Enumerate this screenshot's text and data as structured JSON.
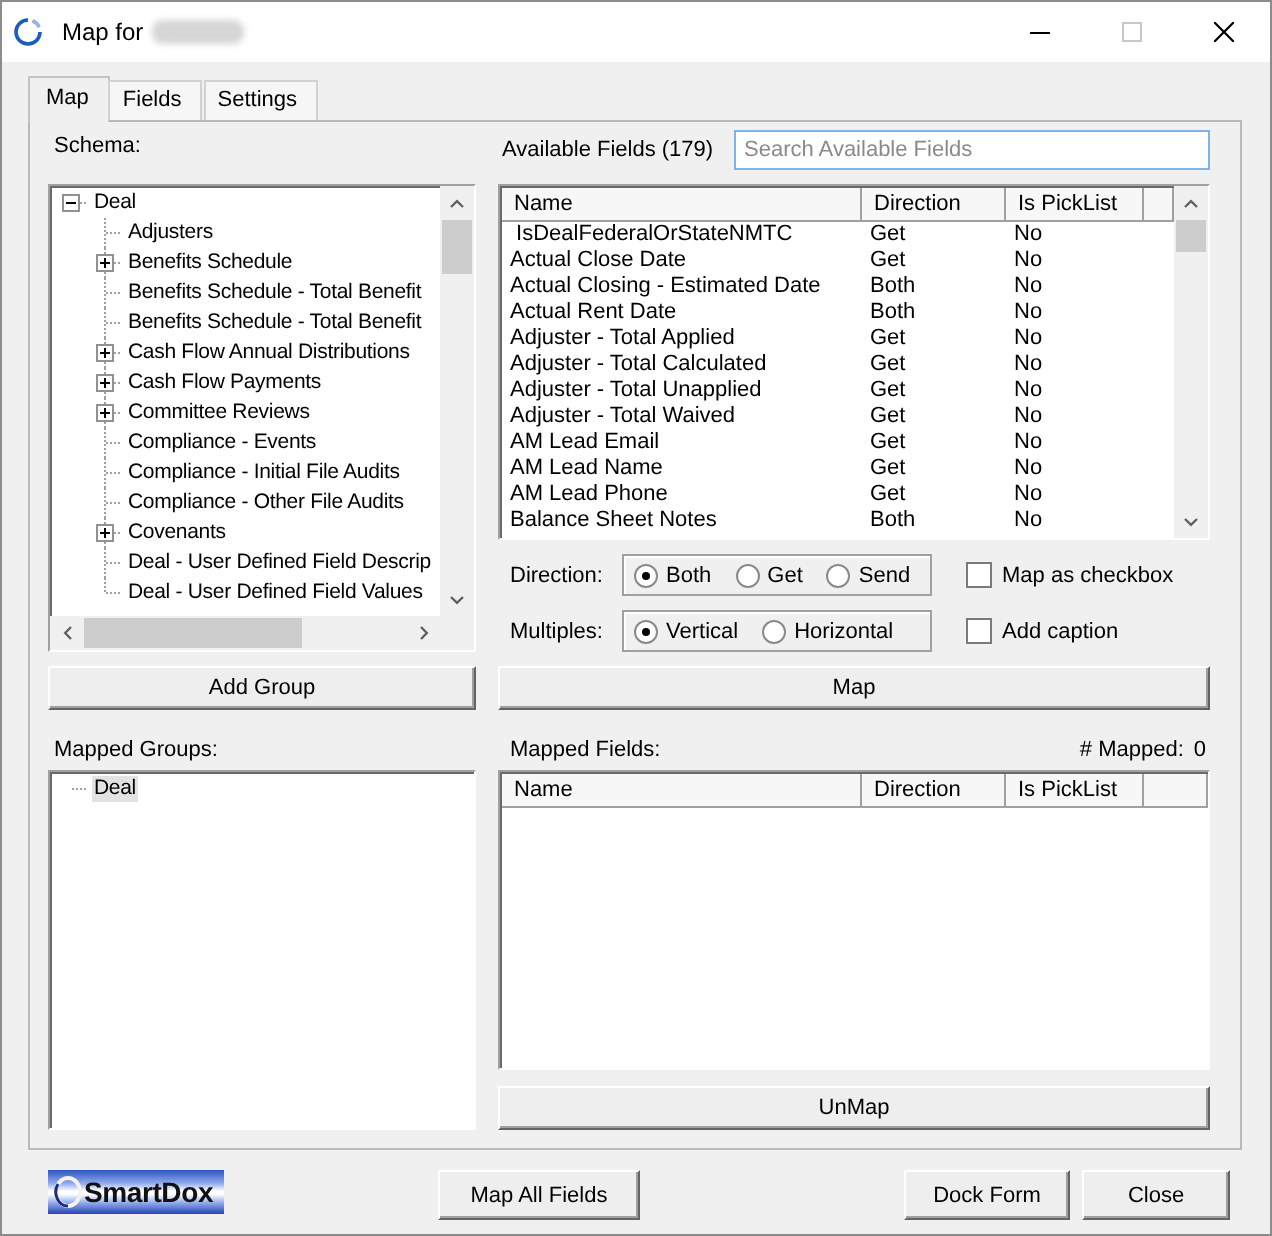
{
  "window": {
    "title": "Map for",
    "controls": [
      {
        "kind": "minimize",
        "disabled": false
      },
      {
        "kind": "maximize",
        "disabled": true
      },
      {
        "kind": "close",
        "disabled": false
      }
    ]
  },
  "tabs": [
    {
      "label": "Map",
      "selected": true
    },
    {
      "label": "Fields",
      "selected": false
    },
    {
      "label": "Settings",
      "selected": false
    }
  ],
  "schema": {
    "label": "Schema:",
    "tree": [
      {
        "label": "Deal",
        "expanded": true,
        "selected": false,
        "children": [
          {
            "label": "Adjusters",
            "selected": false
          },
          {
            "label": "Benefits Schedule",
            "expanded": false,
            "selected": false
          },
          {
            "label": "Benefits Schedule - Total Benefit",
            "selected": false
          },
          {
            "label": "Benefits Schedule - Total Benefit",
            "selected": false
          },
          {
            "label": "Cash Flow Annual Distributions",
            "expanded": false,
            "selected": false
          },
          {
            "label": "Cash Flow Payments",
            "expanded": false,
            "selected": false
          },
          {
            "label": "Committee Reviews",
            "expanded": false,
            "selected": false
          },
          {
            "label": "Compliance - Events",
            "selected": false
          },
          {
            "label": "Compliance - Initial File Audits",
            "selected": false
          },
          {
            "label": "Compliance - Other File Audits",
            "selected": false
          },
          {
            "label": "Covenants",
            "expanded": false,
            "selected": false
          },
          {
            "label": "Deal - User Defined Field Descrip",
            "selected": false
          },
          {
            "label": "Deal - User Defined Field Values",
            "selected": false
          }
        ]
      }
    ]
  },
  "available_fields": {
    "label": "Available Fields (179)",
    "search": {
      "placeholder": "Search Available Fields"
    },
    "columns": [
      "Name",
      "Direction",
      "Is PickList"
    ],
    "rows": [
      {
        "name": " IsDealFederalOrStateNMTC",
        "direction": "Get",
        "is_picklist": "No",
        "selected": false
      },
      {
        "name": "Actual Close Date",
        "direction": "Get",
        "is_picklist": "No",
        "selected": false
      },
      {
        "name": "Actual Closing - Estimated Date",
        "direction": "Both",
        "is_picklist": "No",
        "selected": false
      },
      {
        "name": "Actual Rent Date",
        "direction": "Both",
        "is_picklist": "No",
        "selected": false
      },
      {
        "name": "Adjuster - Total Applied",
        "direction": "Get",
        "is_picklist": "No",
        "selected": false
      },
      {
        "name": "Adjuster - Total Calculated",
        "direction": "Get",
        "is_picklist": "No",
        "selected": false
      },
      {
        "name": "Adjuster - Total Unapplied",
        "direction": "Get",
        "is_picklist": "No",
        "selected": false
      },
      {
        "name": "Adjuster - Total Waived",
        "direction": "Get",
        "is_picklist": "No",
        "selected": false
      },
      {
        "name": "AM Lead Email",
        "direction": "Get",
        "is_picklist": "No",
        "selected": false
      },
      {
        "name": "AM Lead Name",
        "direction": "Get",
        "is_picklist": "No",
        "selected": false
      },
      {
        "name": "AM Lead Phone",
        "direction": "Get",
        "is_picklist": "No",
        "selected": false
      },
      {
        "name": "Balance Sheet Notes",
        "direction": "Both",
        "is_picklist": "No",
        "selected": false
      }
    ]
  },
  "direction": {
    "label": "Direction:",
    "options": [
      {
        "label": "Both",
        "selected": true
      },
      {
        "label": "Get",
        "selected": false
      },
      {
        "label": "Send",
        "selected": false
      }
    ]
  },
  "map_as_checkbox": {
    "label": "Map as checkbox",
    "checked": false
  },
  "multiples": {
    "label": "Multiples:",
    "options": [
      {
        "label": "Vertical",
        "selected": true
      },
      {
        "label": "Horizontal",
        "selected": false
      }
    ]
  },
  "add_caption": {
    "label": "Add caption",
    "checked": false
  },
  "add_group_button": "Add Group",
  "map_button": "Map",
  "mapped_groups": {
    "label": "Mapped Groups:",
    "tree": [
      {
        "label": "Deal",
        "selected": true
      }
    ]
  },
  "mapped_fields": {
    "label": "Mapped Fields:",
    "count_label": "# Mapped:",
    "count": "0",
    "columns": [
      "Name",
      "Direction",
      "Is PickList"
    ]
  },
  "unmap_button": "UnMap",
  "footer": {
    "logo": "SmartDox",
    "buttons": [
      "Map All Fields",
      "Dock Form",
      "Close"
    ]
  }
}
